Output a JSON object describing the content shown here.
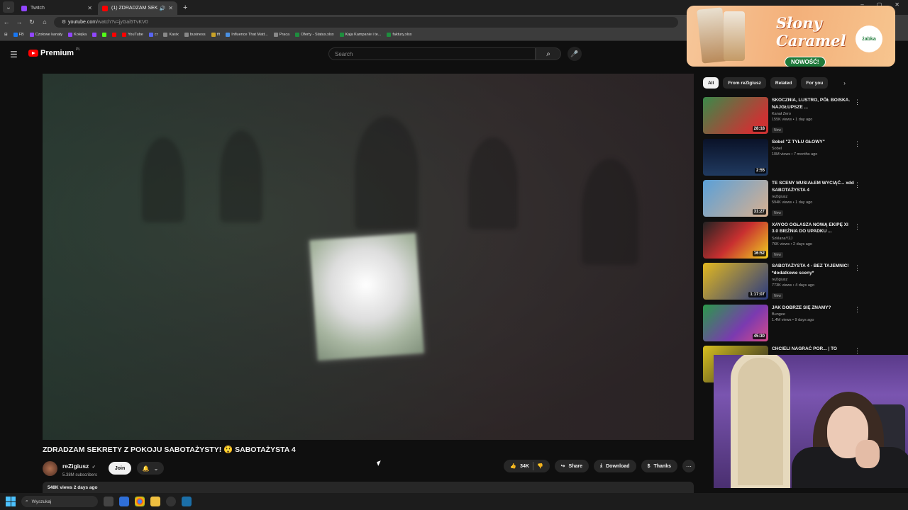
{
  "browser": {
    "tabs": [
      {
        "title": "Twitch",
        "color": "#9146ff"
      },
      {
        "title": "(1) ZDRADZAM SEKRETY Z",
        "color": "#ff0000",
        "active": true
      }
    ],
    "url_host": "youtube.com",
    "url_path": "/watch?v=jyGai5TvKV0",
    "bookmarks": [
      "FB",
      "Czołowe kanały",
      "Kolejka",
      "",
      "",
      "",
      "YouTube",
      "cr",
      "Kasix",
      "business",
      "tft",
      "Influence That Matt...",
      "Praca",
      "Oferty - Status.xlsx",
      "Kaja Kampanie i te...",
      "faktury.xlsx"
    ]
  },
  "header": {
    "logo": "Premium",
    "region": "PL",
    "search_placeholder": "Search"
  },
  "ad": {
    "slogan": "Słony Caramel",
    "badge": "NOWOŚĆ!",
    "brand": "żabka"
  },
  "video": {
    "title": "ZDRADZAM SEKRETY Z POKOJU SABOTAŻYSTY! 😲 SABOTAŻYSTA 4",
    "channel": "reZigiusz",
    "subscribers": "5.38M subscribers",
    "join": "Join",
    "likes": "34K",
    "share": "Share",
    "download": "Download",
    "thanks": "Thanks",
    "views_date": "548K views  2 days ago"
  },
  "chips": [
    "All",
    "From reZigiusz",
    "Related",
    "For you"
  ],
  "recommendations": [
    {
      "title": "SKOCZNIA, LUSTRO, PÓŁ BOISKA. NAJGŁUPSZE ...",
      "channel": "Kanał Zero",
      "meta": "155K views • 1 day ago",
      "badge": "New",
      "duration": "28:18",
      "color": "#3a8a4a"
    },
    {
      "title": "Sobel \"Z TYŁU GŁOWY\"",
      "channel": "Sobel",
      "meta": "10M views • 7 months ago",
      "badge": "",
      "duration": "2:55",
      "color": "#102040"
    },
    {
      "title": "TE SCENY MUSIAŁEM WYCIĄĆ... xdd SABOTAŻYSTA 4",
      "channel": "reZigiusz",
      "meta": "594K views • 1 day ago",
      "badge": "New",
      "duration": "31:27",
      "color": "#5aa0d8"
    },
    {
      "title": "XAYOO OGŁASZA NOWĄ EKIPĘ XI 3.0 BIEŻNIA DO UPADKU ...",
      "channel": "SzklanaY2J",
      "meta": "76K views • 2 days ago",
      "badge": "New",
      "duration": "16:52",
      "color": "#c83030"
    },
    {
      "title": "SABOTAŻYSTA 4 - BEZ TAJEMNIC! *dodatkowe sceny*",
      "channel": "reZigiusz",
      "meta": "773K views • 4 days ago",
      "badge": "New",
      "duration": "1:17:07",
      "color": "#e2b820"
    },
    {
      "title": "JAK DOBRZE SIĘ ZNAMY?",
      "channel": "Bungee",
      "meta": "1.4M views • 9 days ago",
      "badge": "",
      "duration": "45:30",
      "color": "#7a3ab0"
    },
    {
      "title": "CHCIELI NAGRAĆ POR... | TO",
      "channel": "",
      "meta": "",
      "badge": "",
      "duration": "",
      "color": "#d8c020"
    }
  ],
  "taskbar": {
    "search": "Wyszukaj"
  }
}
